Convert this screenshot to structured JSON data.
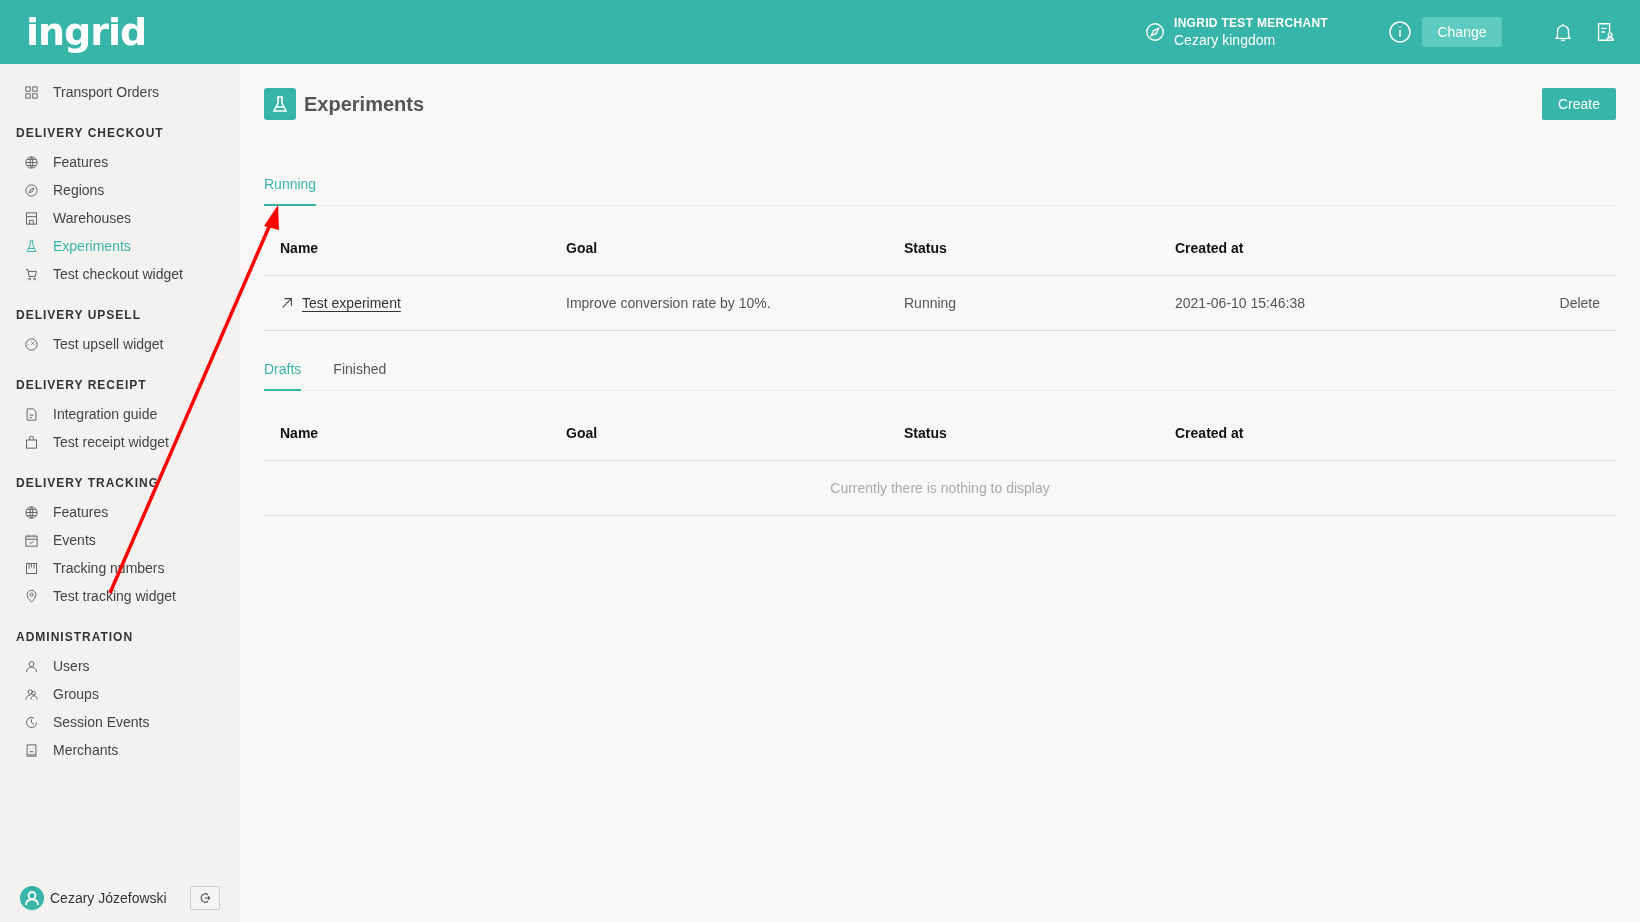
{
  "header": {
    "logo": "ingrid",
    "merchant": {
      "name": "INGRID TEST MERCHANT",
      "site": "Cezary kingdom"
    },
    "change_button": "Change"
  },
  "sidebar": {
    "sections": [
      {
        "items": [
          {
            "label": "Transport Orders",
            "selected": false
          }
        ]
      },
      {
        "heading": "DELIVERY CHECKOUT",
        "items": [
          {
            "label": "Features",
            "selected": false
          },
          {
            "label": "Regions",
            "selected": false
          },
          {
            "label": "Warehouses",
            "selected": false
          },
          {
            "label": "Experiments",
            "selected": true
          },
          {
            "label": "Test checkout widget",
            "selected": false
          }
        ]
      },
      {
        "heading": "DELIVERY UPSELL",
        "items": [
          {
            "label": "Test upsell widget",
            "selected": false
          }
        ]
      },
      {
        "heading": "DELIVERY RECEIPT",
        "items": [
          {
            "label": "Integration guide",
            "selected": false
          },
          {
            "label": "Test receipt widget",
            "selected": false
          }
        ]
      },
      {
        "heading": "DELIVERY TRACKING",
        "items": [
          {
            "label": "Features",
            "selected": false
          },
          {
            "label": "Events",
            "selected": false
          },
          {
            "label": "Tracking numbers",
            "selected": false
          },
          {
            "label": "Test tracking widget",
            "selected": false
          }
        ]
      },
      {
        "heading": "ADMINISTRATION",
        "items": [
          {
            "label": "Users",
            "selected": false
          },
          {
            "label": "Groups",
            "selected": false
          },
          {
            "label": "Session Events",
            "selected": false
          },
          {
            "label": "Merchants",
            "selected": false
          }
        ]
      }
    ],
    "user": "Cezary Józefowski"
  },
  "page": {
    "title": "Experiments",
    "create_button": "Create"
  },
  "running": {
    "tabs": [
      {
        "label": "Running",
        "selected": true
      }
    ],
    "columns": [
      "Name",
      "Goal",
      "Status",
      "Created at"
    ],
    "rows": [
      {
        "name": "Test experiment",
        "goal": "Improve conversion rate by 10%.",
        "status": "Running",
        "created_at": "2021-06-10 15:46:38",
        "action": "Delete"
      }
    ]
  },
  "other": {
    "tabs": [
      {
        "label": "Drafts",
        "selected": true
      },
      {
        "label": "Finished",
        "selected": false
      }
    ],
    "columns": [
      "Name",
      "Goal",
      "Status",
      "Created at"
    ],
    "empty_message": "Currently there is nothing to display"
  }
}
